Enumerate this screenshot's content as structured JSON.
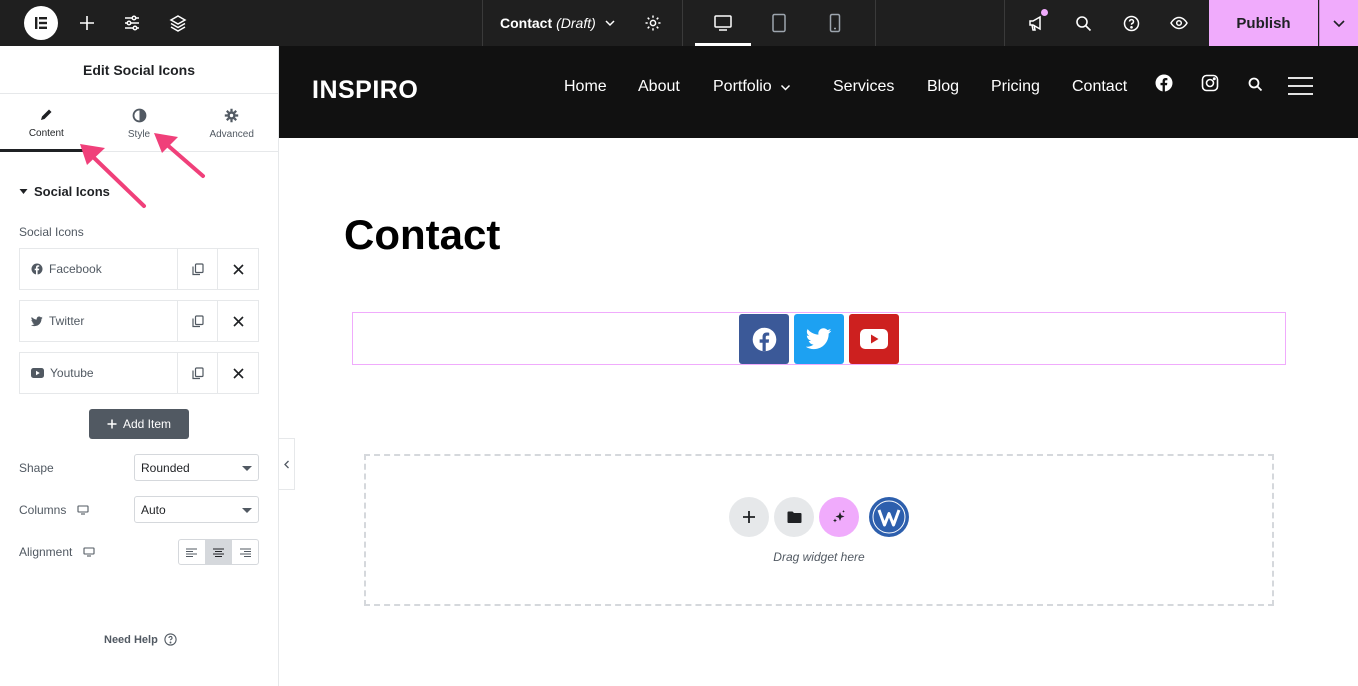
{
  "topbar": {
    "document_title": "Contact",
    "document_status": "(Draft)",
    "publish_label": "Publish"
  },
  "panel": {
    "header": "Edit Social Icons",
    "tabs": [
      {
        "label": "Content",
        "icon": "pencil-icon",
        "active": true
      },
      {
        "label": "Style",
        "icon": "half-circle-icon",
        "active": false
      },
      {
        "label": "Advanced",
        "icon": "gear-icon",
        "active": false
      }
    ],
    "section_title": "Social Icons",
    "repeater_label": "Social Icons",
    "items": [
      {
        "label": "Facebook",
        "icon": "facebook-icon"
      },
      {
        "label": "Twitter",
        "icon": "twitter-icon"
      },
      {
        "label": "Youtube",
        "icon": "youtube-icon"
      }
    ],
    "add_item_label": "Add Item",
    "shape_label": "Shape",
    "shape_value": "Rounded",
    "columns_label": "Columns",
    "columns_value": "Auto",
    "alignment_label": "Alignment",
    "alignment_value": "center",
    "need_help": "Need Help"
  },
  "site": {
    "logo": "INSPIRO",
    "nav": [
      "Home",
      "About",
      "Portfolio",
      "Services",
      "Blog",
      "Pricing",
      "Contact"
    ],
    "page_title": "Contact",
    "social_buttons": [
      {
        "icon": "facebook-icon",
        "color": "#3b5998"
      },
      {
        "icon": "twitter-icon",
        "color": "#1da1f2"
      },
      {
        "icon": "youtube-icon",
        "color": "#cd201f"
      }
    ],
    "drop_zone_text": "Drag widget here"
  },
  "colors": {
    "accent": "#f0abfc",
    "topbar_bg": "#1f1f1f",
    "site_header_bg": "#111111",
    "annotation_arrow": "#f0407a"
  }
}
